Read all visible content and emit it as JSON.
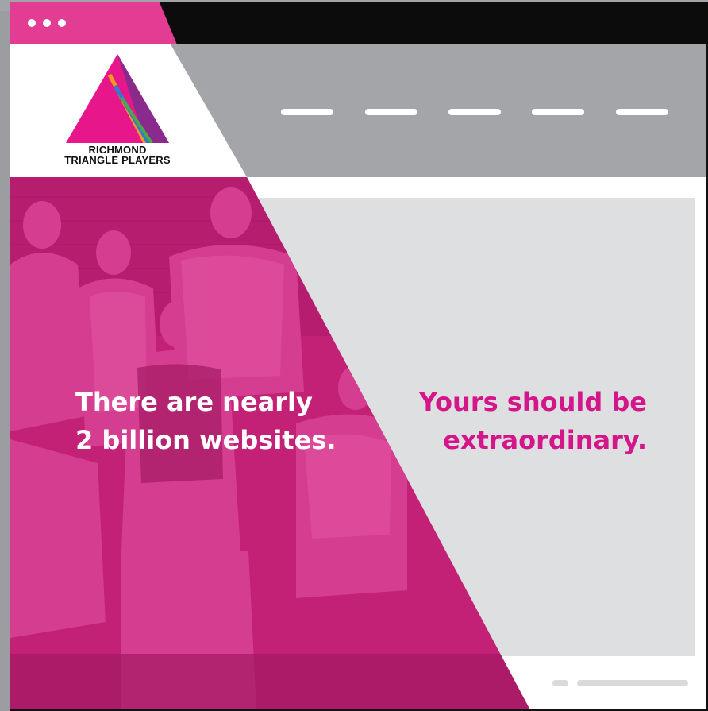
{
  "window": {
    "controls": [
      "dot",
      "dot",
      "dot"
    ],
    "accent_color": "#e23c93"
  },
  "logo": {
    "line1": "RICHMOND",
    "line2": "TRIANGLE PLAYERS",
    "colors": [
      "#e8168b",
      "#8a2a8c",
      "#f59a23",
      "#2e7bd1",
      "#4aa84a"
    ]
  },
  "nav": {
    "items": [
      "nav-link",
      "nav-link",
      "nav-link",
      "nav-link",
      "nav-link"
    ]
  },
  "hero": {
    "left_line1": "There are nearly",
    "left_line2": "2 billion websites.",
    "right_line1": "Yours should be",
    "right_line2": "extraordinary."
  },
  "colors": {
    "pink_overlay": "#d4168a",
    "headline_accent": "#d4168a",
    "nav_gray": "#a4a5a8",
    "content_gray": "#dedfe1"
  }
}
